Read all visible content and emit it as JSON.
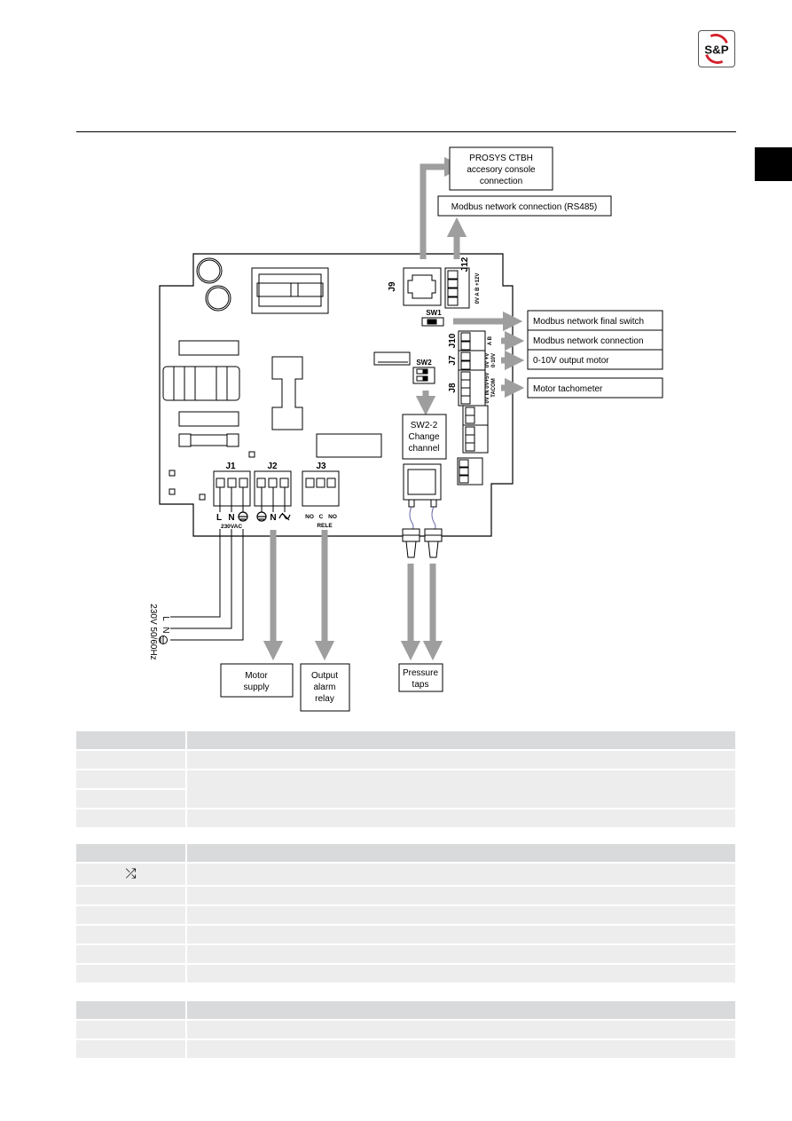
{
  "header": {
    "logo_text": "S&P",
    "brand_color": "#d4202c"
  },
  "diagram": {
    "callouts": {
      "prosys_line1": "PROSYS CTBH",
      "prosys_line2": "accesory console",
      "prosys_line3": "connection",
      "modbus_rs485": "Modbus network connection (RS485)",
      "modbus_final_switch": "Modbus network final switch",
      "modbus_connection": "Modbus network connection",
      "output_0_10v": "0-10V output motor",
      "motor_tacho": "Motor tachometer",
      "sw22_line1": "SW2-2",
      "sw22_line2": "Change",
      "sw22_line3": "channel",
      "motor_supply_line1": "Motor",
      "motor_supply_line2": "supply",
      "alarm_line1": "Output",
      "alarm_line2": "alarm",
      "alarm_line3": "relay",
      "pressure_line1": "Pressure",
      "pressure_line2": "taps"
    },
    "connectors": {
      "j1": "J1",
      "j2": "J2",
      "j3": "J3",
      "j7": "J7",
      "j8": "J8",
      "j9": "J9",
      "j10": "J10",
      "j12": "J12",
      "sw1": "SW1",
      "sw2": "SW2"
    },
    "pin_labels": {
      "j1_l": "L",
      "j1_n": "N",
      "j1_voltage": "230VAC",
      "j2_n": "N",
      "j3_no1": "NO",
      "j3_c": "C",
      "j3_no2": "NO",
      "j3_name": "RELE",
      "j12_pins": "0V  A  B +12V",
      "j10_pins": "A   B",
      "j7_pins": "0V +V",
      "j7_range": "0-10V",
      "j8_pins": "0V IN 0V+5V",
      "j8_name": "TACOM"
    },
    "mains": {
      "l": "L",
      "n": "N",
      "spec": "230V 50/60Hz"
    }
  },
  "tables": [
    {
      "rows": [
        {
          "type": "head",
          "c1": "",
          "c2": ""
        },
        {
          "type": "row",
          "c1": "",
          "c2": ""
        },
        {
          "type": "row",
          "c1": "",
          "c2": ""
        },
        {
          "type": "row",
          "c1": "",
          "c2": ""
        },
        {
          "type": "row",
          "c1": "",
          "c2": ""
        }
      ]
    },
    {
      "rows": [
        {
          "type": "head",
          "c1": "",
          "c2": ""
        },
        {
          "type": "row",
          "c1": "⤮",
          "c2": "",
          "icon": "motor-phase-icon"
        },
        {
          "type": "row",
          "c1": "",
          "c2": ""
        },
        {
          "type": "row",
          "c1": "",
          "c2": ""
        },
        {
          "type": "row",
          "c1": "",
          "c2": ""
        },
        {
          "type": "row",
          "c1": "",
          "c2": ""
        },
        {
          "type": "row",
          "c1": "",
          "c2": ""
        }
      ]
    },
    {
      "rows": [
        {
          "type": "head",
          "c1": "",
          "c2": ""
        },
        {
          "type": "row",
          "c1": "",
          "c2": ""
        },
        {
          "type": "row",
          "c1": "",
          "c2": ""
        }
      ]
    }
  ]
}
